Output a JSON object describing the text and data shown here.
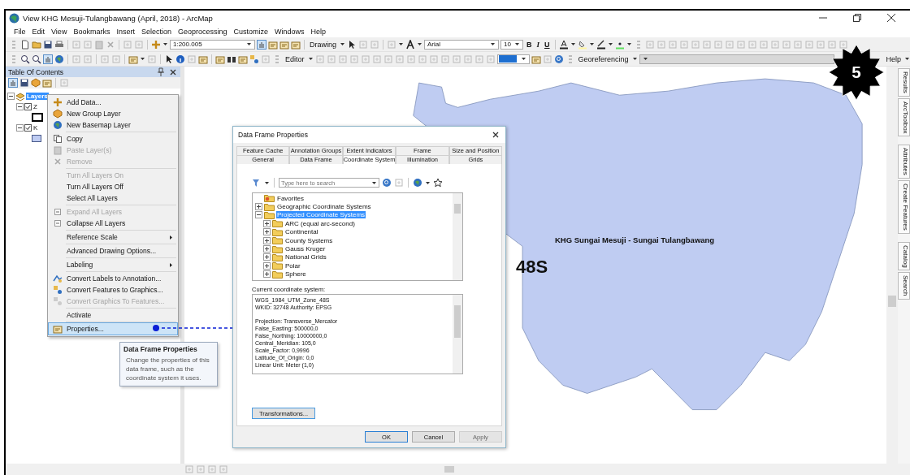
{
  "window": {
    "title": "View KHG Mesuji-Tulangbawang (April, 2018) - ArcMap"
  },
  "menu_bar": [
    "File",
    "Edit",
    "View",
    "Bookmarks",
    "Insert",
    "Selection",
    "Geoprocessing",
    "Customize",
    "Windows",
    "Help"
  ],
  "toolbar_1": {
    "scale": "1:200.005",
    "drawing": "Drawing",
    "font": "Arial",
    "font_size": "10",
    "bold": "B",
    "italic": "I",
    "underline": "U"
  },
  "toolbar_2": {
    "editor": "Editor",
    "georeferencing": "Georeferencing",
    "help": "Help"
  },
  "toc": {
    "title": "Table Of Contents",
    "layers": [
      {
        "label": "Layers",
        "selected": true,
        "expanded": true,
        "children": [
          {
            "label": "Z",
            "checked": true,
            "expanded": true
          },
          {
            "label": "K",
            "checked": true,
            "expanded": true
          }
        ]
      }
    ]
  },
  "context_menu": {
    "groups": [
      [
        {
          "label": "Add Data...",
          "disabled": false,
          "selected": false,
          "submenu": false
        },
        {
          "label": "New Group Layer",
          "disabled": false,
          "selected": false,
          "submenu": false
        },
        {
          "label": "New Basemap Layer",
          "disabled": false,
          "selected": false,
          "submenu": false
        }
      ],
      [
        {
          "label": "Copy",
          "disabled": false,
          "selected": false,
          "submenu": false
        },
        {
          "label": "Paste Layer(s)",
          "disabled": true,
          "selected": false,
          "submenu": false
        },
        {
          "label": "Remove",
          "disabled": true,
          "selected": false,
          "submenu": false
        }
      ],
      [
        {
          "label": "Turn All Layers On",
          "disabled": true,
          "selected": false,
          "submenu": false
        },
        {
          "label": "Turn All Layers Off",
          "disabled": false,
          "selected": false,
          "submenu": false
        },
        {
          "label": "Select All Layers",
          "disabled": false,
          "selected": false,
          "submenu": false
        }
      ],
      [
        {
          "label": "Expand All Layers",
          "disabled": true,
          "selected": false,
          "submenu": false
        },
        {
          "label": "Collapse All Layers",
          "disabled": false,
          "selected": false,
          "submenu": false
        }
      ],
      [
        {
          "label": "Reference Scale",
          "disabled": false,
          "selected": false,
          "submenu": true
        }
      ],
      [
        {
          "label": "Advanced Drawing Options...",
          "disabled": false,
          "selected": false,
          "submenu": false
        }
      ],
      [
        {
          "label": "Labeling",
          "disabled": false,
          "selected": false,
          "submenu": true
        }
      ],
      [
        {
          "label": "Convert Labels to Annotation...",
          "disabled": false,
          "selected": false,
          "submenu": false
        },
        {
          "label": "Convert Features to Graphics...",
          "disabled": false,
          "selected": false,
          "submenu": false
        },
        {
          "label": "Convert Graphics To Features...",
          "disabled": true,
          "selected": false,
          "submenu": false
        }
      ],
      [
        {
          "label": "Activate",
          "disabled": false,
          "selected": false,
          "submenu": false
        }
      ],
      [
        {
          "label": "Properties...",
          "disabled": false,
          "selected": true,
          "submenu": false
        }
      ]
    ]
  },
  "tooltip": {
    "title": "Data Frame Properties",
    "text": "Change the properties of this data frame, such as the coordinate system it uses."
  },
  "dialog": {
    "title": "Data Frame Properties",
    "tab_rows": [
      [
        {
          "label": "Feature Cache",
          "selected": false
        },
        {
          "label": "Annotation Groups",
          "selected": false
        },
        {
          "label": "Extent Indicators",
          "selected": false
        },
        {
          "label": "Frame",
          "selected": false
        },
        {
          "label": "Size and Position",
          "selected": false
        }
      ],
      [
        {
          "label": "General",
          "selected": false
        },
        {
          "label": "Data Frame",
          "selected": false
        },
        {
          "label": "Coordinate System",
          "selected": true
        },
        {
          "label": "Illumination",
          "selected": false
        },
        {
          "label": "Grids",
          "selected": false
        }
      ]
    ],
    "search": {
      "placeholder": "Type here to search"
    },
    "coord_tree": [
      {
        "label": "Favorites",
        "kind": "favorites",
        "selected": false
      },
      {
        "label": "Geographic Coordinate Systems",
        "kind": "folder",
        "expanded": false,
        "selected": false
      },
      {
        "label": "Projected Coordinate Systems",
        "kind": "folder",
        "expanded": true,
        "selected": true,
        "children": [
          {
            "label": "ARC (equal arc-second)",
            "kind": "folder",
            "expanded": false,
            "selected": false
          },
          {
            "label": "Continental",
            "kind": "folder",
            "expanded": false,
            "selected": false
          },
          {
            "label": "County Systems",
            "kind": "folder",
            "expanded": false,
            "selected": false
          },
          {
            "label": "Gauss Kruger",
            "kind": "folder",
            "expanded": false,
            "selected": false
          },
          {
            "label": "National Grids",
            "kind": "folder",
            "expanded": false,
            "selected": false
          },
          {
            "label": "Polar",
            "kind": "folder",
            "expanded": false,
            "selected": false
          },
          {
            "label": "Sphere",
            "kind": "folder",
            "expanded": false,
            "selected": false
          }
        ]
      }
    ],
    "current_label": "Current coordinate system:",
    "details": [
      [
        "WGS_1984_UTM_Zone_48S",
        "WKID: 32748 Authority: EPSG"
      ],
      [
        "Projection: Transverse_Mercator",
        "False_Easting: 500000,0",
        "False_Northing: 10000000,0",
        "Central_Meridian: 105,0",
        "Scale_Factor: 0,9996",
        "Latitude_Of_Origin: 0,0",
        "Linear Unit: Meter (1,0)"
      ]
    ],
    "buttons": [
      {
        "label": "Transformations...",
        "kind": "side",
        "disabled": false
      },
      {
        "label": "OK",
        "kind": "default",
        "disabled": false
      },
      {
        "label": "Cancel",
        "kind": "normal",
        "disabled": false
      },
      {
        "label": "Apply",
        "kind": "normal",
        "disabled": true
      }
    ]
  },
  "map": {
    "area_label": "KHG Sungai Mesuji - Sungai Tulangbawang",
    "zone_label": "48S"
  },
  "badge": "5",
  "side_tabs": [
    [
      "Results",
      "ArcToolbox"
    ],
    [
      "Attributes",
      "Create Features"
    ],
    [
      "Catalog",
      "Search"
    ]
  ]
}
